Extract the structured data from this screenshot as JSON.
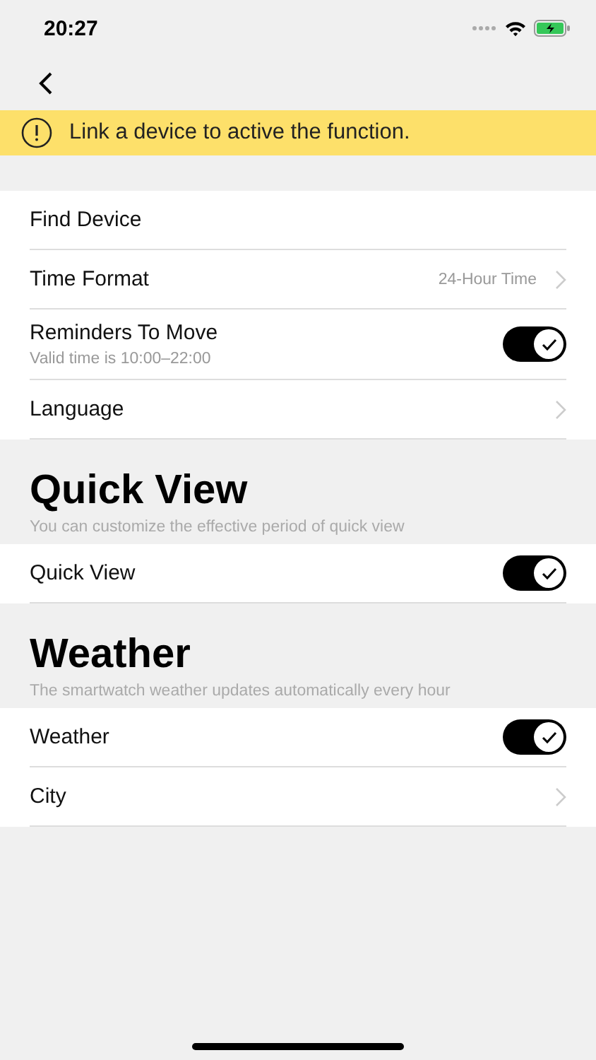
{
  "status_bar": {
    "time": "20:27"
  },
  "banner": {
    "message": "Link a device to active the function."
  },
  "sections": [
    {
      "rows": [
        {
          "kind": "plain",
          "label": "Find Device"
        },
        {
          "kind": "link",
          "label": "Time Format",
          "value": "24-Hour Time"
        },
        {
          "kind": "toggle",
          "label": "Reminders To Move",
          "note": "Valid time is 10:00–22:00",
          "on": true
        },
        {
          "kind": "link",
          "label": "Language"
        }
      ]
    },
    {
      "title": "Quick View",
      "subtitle": "You can customize the effective period of quick view",
      "rows": [
        {
          "kind": "toggle",
          "label": "Quick View",
          "on": true
        }
      ]
    },
    {
      "title": "Weather",
      "subtitle": "The smartwatch weather updates automatically every hour",
      "rows": [
        {
          "kind": "toggle",
          "label": "Weather",
          "on": true
        },
        {
          "kind": "link",
          "label": "City"
        }
      ]
    }
  ]
}
